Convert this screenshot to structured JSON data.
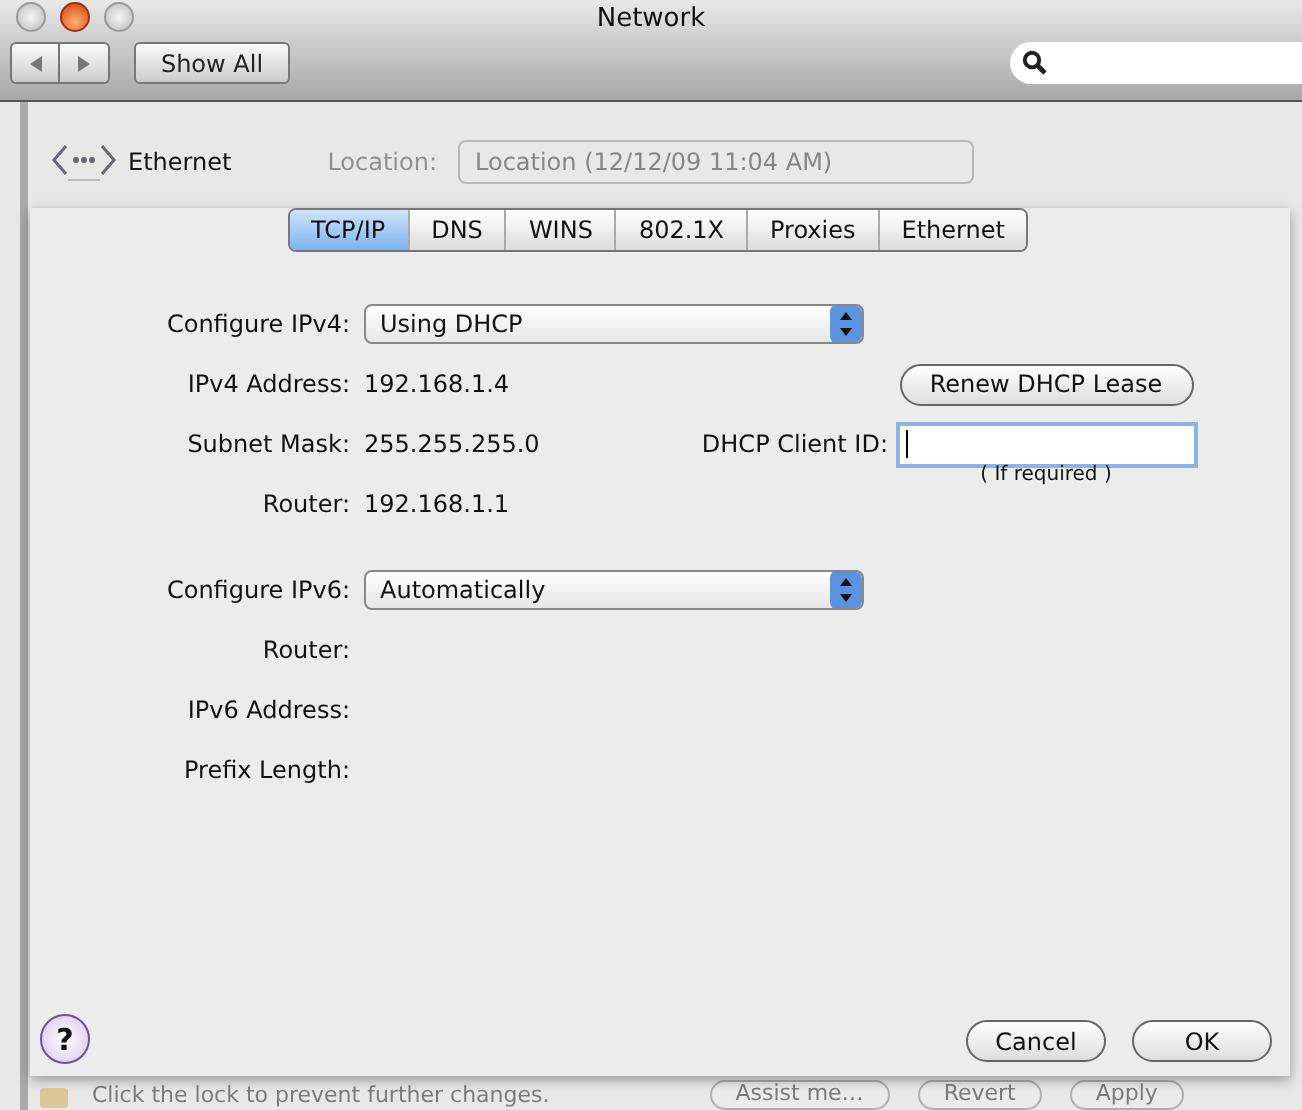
{
  "window": {
    "title": "Network"
  },
  "toolbar": {
    "show_all": "Show All"
  },
  "service": {
    "name": "Ethernet"
  },
  "location": {
    "label": "Location:",
    "value": "Location (12/12/09 11:04 AM)"
  },
  "sheet": {
    "tabs": [
      {
        "label": "TCP/IP",
        "selected": true
      },
      {
        "label": "DNS",
        "selected": false
      },
      {
        "label": "WINS",
        "selected": false
      },
      {
        "label": "802.1X",
        "selected": false
      },
      {
        "label": "Proxies",
        "selected": false
      },
      {
        "label": "Ethernet",
        "selected": false
      }
    ],
    "ipv4": {
      "label": "Configure IPv4:",
      "method": "Using DHCP",
      "fields": [
        {
          "label": "IPv4 Address:",
          "value": "192.168.1.4"
        },
        {
          "label": "Subnet Mask:",
          "value": "255.255.255.0"
        },
        {
          "label": "Router:",
          "value": "192.168.1.1"
        }
      ]
    },
    "renew_button": "Renew DHCP Lease",
    "client_id": {
      "label": "DHCP Client ID:",
      "hint": "( If required )"
    },
    "ipv6": {
      "label": "Configure IPv6:",
      "method": "Automatically",
      "fields": [
        {
          "label": "Router:"
        },
        {
          "label": "IPv6 Address:"
        },
        {
          "label": "Prefix Length:"
        }
      ]
    },
    "help": "?",
    "buttons": [
      "Cancel",
      "OK"
    ]
  },
  "footer": {
    "lock_text": "Click the lock to prevent further changes.",
    "buttons": [
      "Assist me…",
      "Revert",
      "Apply"
    ]
  }
}
